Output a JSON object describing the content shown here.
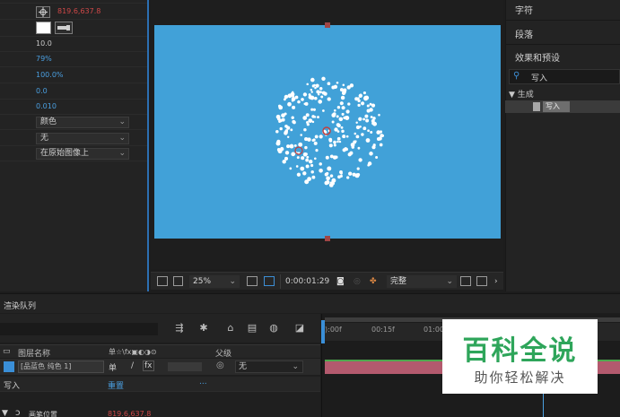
{
  "effect_controls": {
    "position_value": "819.6,637.8",
    "size_value": "10.0",
    "percent_1": "79%",
    "percent_2": "100.0%",
    "value_3": "0.0",
    "value_4": "0.010",
    "dropdown_1": "颜色",
    "dropdown_2": "无",
    "dropdown_3": "在原始图像上"
  },
  "viewer": {
    "zoom": "25%",
    "timecode": "0:00:01:29",
    "resolution": "完整"
  },
  "right_panel": {
    "title_character": "字符",
    "title_paragraph": "段落",
    "title_effects": "效果和预设",
    "search_value": "写入",
    "category": "▼ 生成",
    "item": "写入"
  },
  "timeline": {
    "tab_label": "渲染队列",
    "col_layer_name": "图层名称",
    "col_switches": "单☆\\fx▣◐◑⊙",
    "col_parent": "父级",
    "layer_name": "[品蓝色 纯色 1]",
    "parent_value": "无",
    "sub_effect": "写入",
    "sub_effect_value": "重置",
    "sub_effect_dots": "...",
    "sub_prop": "画笔位置",
    "sub_prop_value": "819.6,637.8",
    "ruler": [
      "):00f",
      "00:15f",
      "01:00f"
    ]
  },
  "watermark": {
    "title": "百科全说",
    "subtitle": "助你轻松解决"
  },
  "colors": {
    "comp_bg": "#41a1d8",
    "accent_blue": "#4a9fe0",
    "value_red": "#d04848",
    "track_red": "#b35a6e",
    "watermark_green": "#2ea55a"
  }
}
